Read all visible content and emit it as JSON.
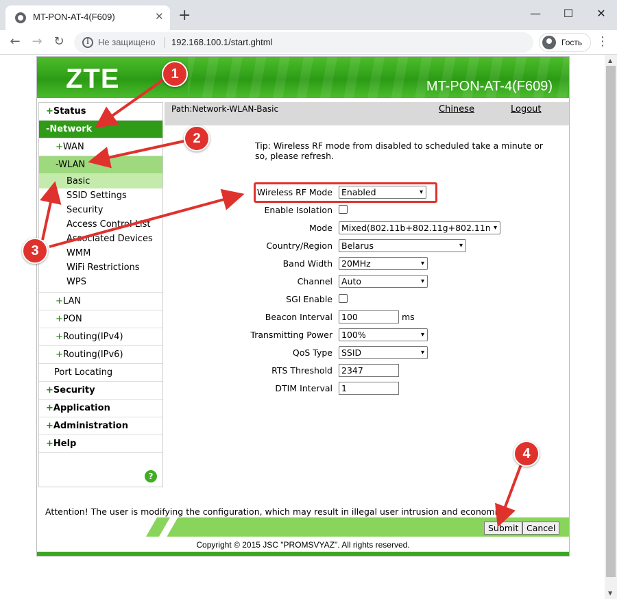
{
  "browser": {
    "tab_title": "MT-PON-AT-4(F609)",
    "tab_close": "✕",
    "new_tab": "+",
    "window_controls": {
      "minimize": "—",
      "maximize": "☐",
      "close": "✕"
    },
    "nav": {
      "back": "←",
      "forward": "→",
      "reload": "↻"
    },
    "security_label": "Не защищено",
    "url": "192.168.100.1/start.ghtml",
    "profile_label": "Гость",
    "menu": "⋮"
  },
  "header": {
    "logo": "ZTE",
    "model": "MT-PON-AT-4(F609)"
  },
  "sidebar": {
    "status": {
      "sign": "+",
      "label": "Status"
    },
    "network": {
      "sign": "-",
      "label": "Network"
    },
    "wan": {
      "sign": "+",
      "label": "WAN"
    },
    "wlan": {
      "sign": "-",
      "label": "WLAN"
    },
    "wlan_items": [
      "Basic",
      "SSID Settings",
      "Security",
      "Access Control List",
      "Associated Devices",
      "WMM",
      "WiFi Restrictions",
      "WPS"
    ],
    "lan": {
      "sign": "+",
      "label": "LAN"
    },
    "pon": {
      "sign": "+",
      "label": "PON"
    },
    "routing_v4": {
      "sign": "+",
      "label": "Routing(IPv4)"
    },
    "routing_v6": {
      "sign": "+",
      "label": "Routing(IPv6)"
    },
    "port_locating": "Port Locating",
    "security": {
      "sign": "+",
      "label": "Security"
    },
    "application": {
      "sign": "+",
      "label": "Application"
    },
    "administration": {
      "sign": "+",
      "label": "Administration"
    },
    "help": {
      "sign": "+",
      "label": "Help"
    },
    "help_icon": "?"
  },
  "pathbar": {
    "path": "Path:Network-WLAN-Basic",
    "chinese": "Chinese",
    "logout": "Logout"
  },
  "tip": "Tip: Wireless RF mode from disabled to scheduled take a minute or so, please refresh.",
  "form": {
    "rf_mode": {
      "label": "Wireless RF Mode",
      "value": "Enabled"
    },
    "isolation": {
      "label": "Enable Isolation",
      "checked": false
    },
    "mode": {
      "label": "Mode",
      "value": "Mixed(802.11b+802.11g+802.11n"
    },
    "country": {
      "label": "Country/Region",
      "value": "Belarus"
    },
    "bandwidth": {
      "label": "Band Width",
      "value": "20MHz"
    },
    "channel": {
      "label": "Channel",
      "value": "Auto"
    },
    "sgi": {
      "label": "SGI Enable",
      "checked": false
    },
    "beacon": {
      "label": "Beacon Interval",
      "value": "100",
      "unit": "ms"
    },
    "tx_power": {
      "label": "Transmitting Power",
      "value": "100%"
    },
    "qos": {
      "label": "QoS Type",
      "value": "SSID"
    },
    "rts": {
      "label": "RTS Threshold",
      "value": "2347"
    },
    "dtim": {
      "label": "DTIM Interval",
      "value": "1"
    }
  },
  "attention": "Attention! The user is modifying the configuration, which may result in illegal user intrusion and economic loss.",
  "buttons": {
    "submit": "Submit",
    "cancel": "Cancel"
  },
  "copyright": "Copyright © 2015 JSC \"PROMSVYAZ\". All rights reserved.",
  "annotations": {
    "badge1": "1",
    "badge2": "2",
    "badge3": "3",
    "badge4": "4",
    "color": "#e0322d"
  },
  "colors": {
    "brand_green": "#2f9b17",
    "highlight_red": "#e0322d"
  },
  "icons": {
    "chevron": "▾"
  }
}
